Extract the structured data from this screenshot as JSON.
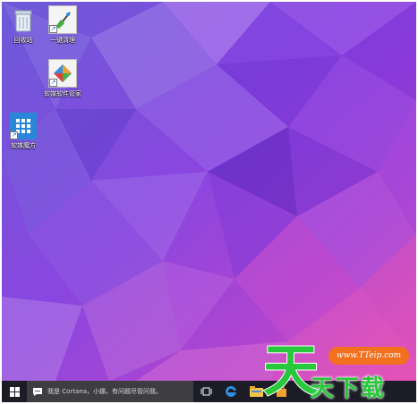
{
  "desktop": {
    "icons": [
      {
        "label": "回收站",
        "icon": "recycle-bin-icon"
      },
      {
        "label": "一键清理",
        "icon": "broom-icon"
      },
      {
        "label": "软媒软件管家",
        "icon": "software-manager-icon"
      },
      {
        "label": "软媒魔方",
        "icon": "cube-app-icon"
      }
    ]
  },
  "taskbar": {
    "search_text": "我是 Cortana，小娜。有问题尽管问我。",
    "buttons": [
      "start-icon",
      "task-view-icon",
      "edge-icon",
      "file-explorer-icon",
      "store-icon"
    ]
  },
  "watermark": {
    "site": "www.TTeip.com",
    "logo_char": "天",
    "name": "天下载"
  },
  "colors": {
    "wallpaper_top": "#8a56e6",
    "wallpaper_bottom": "#d43bb3",
    "taskbar": "#1b1c25",
    "watermark_green": "#28c83c",
    "watermark_orange": "#f2701e"
  }
}
